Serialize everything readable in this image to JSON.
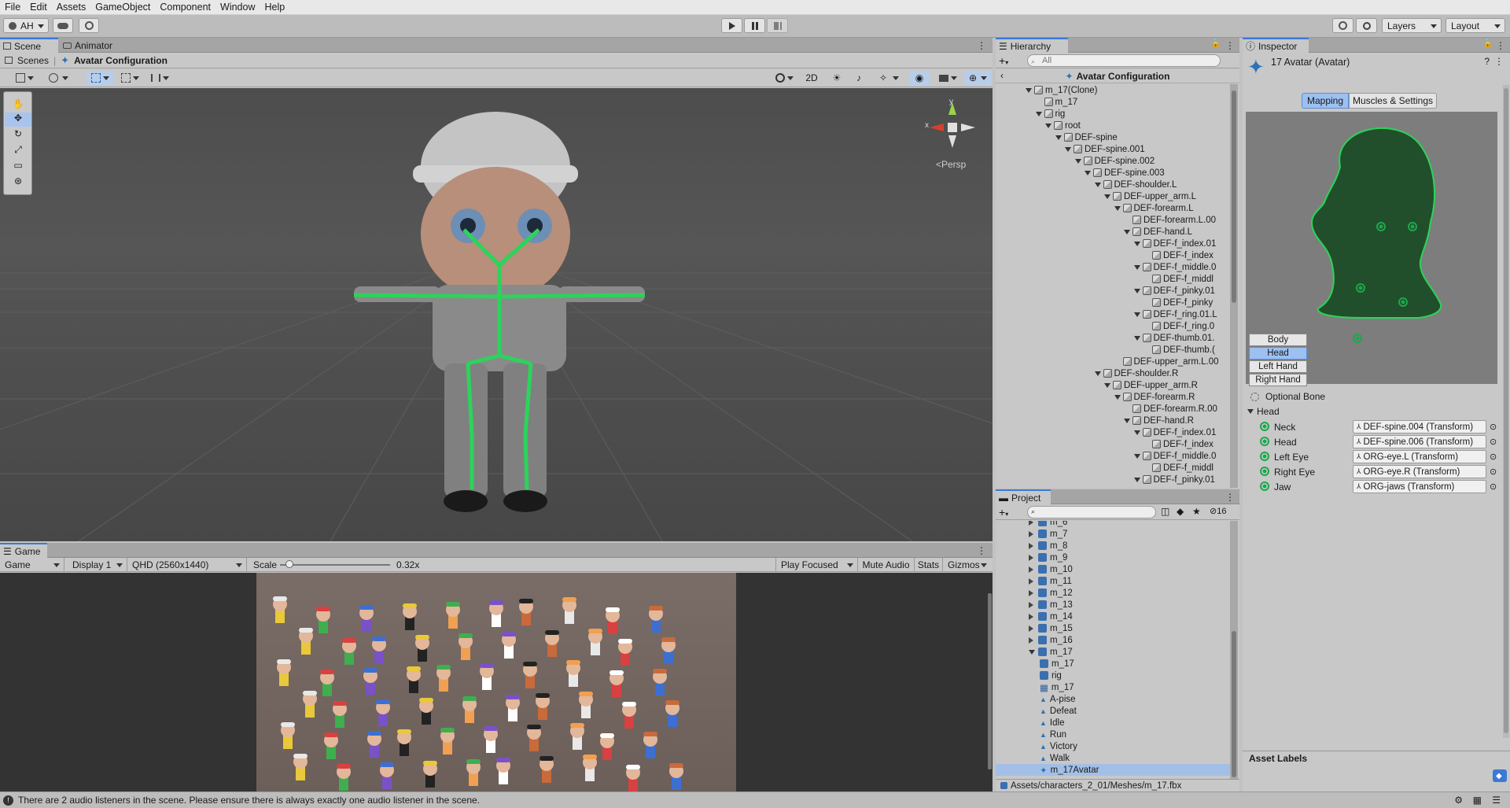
{
  "menu": [
    "File",
    "Edit",
    "Assets",
    "GameObject",
    "Component",
    "Window",
    "Help"
  ],
  "toolbar": {
    "account": "AH",
    "layers": "Layers",
    "layout": "Layout"
  },
  "scene": {
    "tabs": [
      "Scene",
      "Animator"
    ],
    "breadcrumb_root": "Scenes",
    "breadcrumb_current": "Avatar Configuration",
    "mode_2d": "2D",
    "persp": "<Persp",
    "axis_x": "x",
    "axis_y": "y"
  },
  "game": {
    "tab": "Game",
    "view_dropdown": "Game",
    "display": "Display 1",
    "resolution": "QHD (2560x1440)",
    "scale_label": "Scale",
    "scale_value": "0.32x",
    "scale_fraction": 0.05,
    "play_mode": "Play Focused",
    "mute": "Mute Audio",
    "stats": "Stats",
    "gizmos": "Gizmos"
  },
  "hierarchy": {
    "tab": "Hierarchy",
    "search_placeholder": "All",
    "header": "Avatar Configuration",
    "items": [
      {
        "label": "m_17(Clone)",
        "depth": 0,
        "arrow": true
      },
      {
        "label": "m_17",
        "depth": 1,
        "arrow": false
      },
      {
        "label": "rig",
        "depth": 1,
        "arrow": true
      },
      {
        "label": "root",
        "depth": 2,
        "arrow": true
      },
      {
        "label": "DEF-spine",
        "depth": 3,
        "arrow": true
      },
      {
        "label": "DEF-spine.001",
        "depth": 4,
        "arrow": true
      },
      {
        "label": "DEF-spine.002",
        "depth": 5,
        "arrow": true
      },
      {
        "label": "DEF-spine.003",
        "depth": 6,
        "arrow": true
      },
      {
        "label": "DEF-shoulder.L",
        "depth": 7,
        "arrow": true
      },
      {
        "label": "DEF-upper_arm.L",
        "depth": 8,
        "arrow": true
      },
      {
        "label": "DEF-forearm.L",
        "depth": 9,
        "arrow": true
      },
      {
        "label": "DEF-forearm.L.00",
        "depth": 10,
        "arrow": false
      },
      {
        "label": "DEF-hand.L",
        "depth": 10,
        "arrow": true
      },
      {
        "label": "DEF-f_index.01",
        "depth": 11,
        "arrow": true
      },
      {
        "label": "DEF-f_index",
        "depth": 12,
        "arrow": false
      },
      {
        "label": "DEF-f_middle.0",
        "depth": 11,
        "arrow": true
      },
      {
        "label": "DEF-f_middl",
        "depth": 12,
        "arrow": false
      },
      {
        "label": "DEF-f_pinky.01",
        "depth": 11,
        "arrow": true
      },
      {
        "label": "DEF-f_pinky",
        "depth": 12,
        "arrow": false
      },
      {
        "label": "DEF-f_ring.01.L",
        "depth": 11,
        "arrow": true
      },
      {
        "label": "DEF-f_ring.0",
        "depth": 12,
        "arrow": false
      },
      {
        "label": "DEF-thumb.01.",
        "depth": 11,
        "arrow": true
      },
      {
        "label": "DEF-thumb.(",
        "depth": 12,
        "arrow": false
      },
      {
        "label": "DEF-upper_arm.L.00",
        "depth": 9,
        "arrow": false
      },
      {
        "label": "DEF-shoulder.R",
        "depth": 7,
        "arrow": true
      },
      {
        "label": "DEF-upper_arm.R",
        "depth": 8,
        "arrow": true
      },
      {
        "label": "DEF-forearm.R",
        "depth": 9,
        "arrow": true
      },
      {
        "label": "DEF-forearm.R.00",
        "depth": 10,
        "arrow": false
      },
      {
        "label": "DEF-hand.R",
        "depth": 10,
        "arrow": true
      },
      {
        "label": "DEF-f_index.01",
        "depth": 11,
        "arrow": true
      },
      {
        "label": "DEF-f_index",
        "depth": 12,
        "arrow": false
      },
      {
        "label": "DEF-f_middle.0",
        "depth": 11,
        "arrow": true
      },
      {
        "label": "DEF-f_middl",
        "depth": 12,
        "arrow": false
      },
      {
        "label": "DEF-f_pinky.01",
        "depth": 11,
        "arrow": true
      }
    ]
  },
  "project": {
    "tab": "Project",
    "count": "16",
    "items": [
      {
        "label": "m_6",
        "depth": 0,
        "kind": "model"
      },
      {
        "label": "m_7",
        "depth": 0,
        "kind": "model"
      },
      {
        "label": "m_8",
        "depth": 0,
        "kind": "model"
      },
      {
        "label": "m_9",
        "depth": 0,
        "kind": "model"
      },
      {
        "label": "m_10",
        "depth": 0,
        "kind": "model"
      },
      {
        "label": "m_11",
        "depth": 0,
        "kind": "model"
      },
      {
        "label": "m_12",
        "depth": 0,
        "kind": "model"
      },
      {
        "label": "m_13",
        "depth": 0,
        "kind": "model"
      },
      {
        "label": "m_14",
        "depth": 0,
        "kind": "model"
      },
      {
        "label": "m_15",
        "depth": 0,
        "kind": "model"
      },
      {
        "label": "m_16",
        "depth": 0,
        "kind": "model"
      },
      {
        "label": "m_17",
        "depth": 0,
        "kind": "model-open"
      },
      {
        "label": "m_17",
        "depth": 1,
        "kind": "mesh"
      },
      {
        "label": "rig",
        "depth": 1,
        "kind": "mesh"
      },
      {
        "label": "m_17",
        "depth": 1,
        "kind": "grid"
      },
      {
        "label": "A-pise",
        "depth": 1,
        "kind": "anim"
      },
      {
        "label": "Defeat",
        "depth": 1,
        "kind": "anim"
      },
      {
        "label": "Idle",
        "depth": 1,
        "kind": "anim"
      },
      {
        "label": "Run",
        "depth": 1,
        "kind": "anim"
      },
      {
        "label": "Victory",
        "depth": 1,
        "kind": "anim"
      },
      {
        "label": "Walk",
        "depth": 1,
        "kind": "anim"
      },
      {
        "label": "m_17Avatar",
        "depth": 1,
        "kind": "avatar"
      }
    ],
    "path": "Assets/characters_2_01/Meshes/m_17.fbx"
  },
  "inspector": {
    "tab": "Inspector",
    "title": "17 Avatar (Avatar)",
    "tab_mapping": "Mapping",
    "tab_muscles": "Muscles & Settings",
    "body_parts": [
      "Body",
      "Head",
      "Left Hand",
      "Right Hand"
    ],
    "selected_part": "Head",
    "optional_bone": "Optional Bone",
    "section": "Head",
    "bones": [
      {
        "name": "Neck",
        "value": "DEF-spine.004 (Transform)"
      },
      {
        "name": "Head",
        "value": "DEF-spine.006 (Transform)"
      },
      {
        "name": "Left Eye",
        "value": "ORG-eye.L (Transform)"
      },
      {
        "name": "Right Eye",
        "value": "ORG-eye.R (Transform)"
      },
      {
        "name": "Jaw",
        "value": "ORG-jaws (Transform)"
      }
    ],
    "asset_labels": "Asset Labels"
  },
  "status": "There are 2 audio listeners in the scene. Please ensure there is always exactly one audio listener in the scene.",
  "colors": {
    "accent": "#3a79d6",
    "bone_green": "#2bd45a",
    "viewport_bg": "#4a4a4a"
  }
}
